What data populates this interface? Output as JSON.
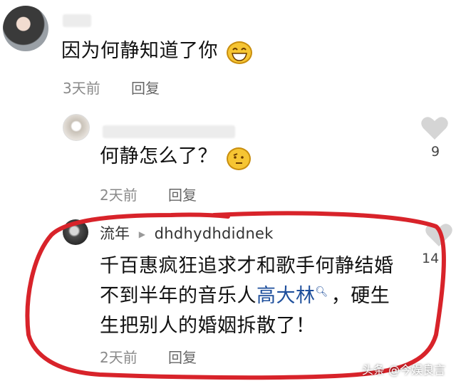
{
  "comments": [
    {
      "text": "因为何静知道了你",
      "time": "3天前",
      "reply_label": "回复"
    },
    {
      "text": "何静怎么了？",
      "time": "2天前",
      "reply_label": "回复",
      "likes": "9"
    },
    {
      "author": "流年",
      "reply_to": "dhdhydhdidnek",
      "text_line1": "千百惠疯狂追求才和歌手何静结婚",
      "text_line2_pre": "不到半年的音乐人",
      "mention": "高大林",
      "text_line2_post": "，硬生",
      "text_line3": "生把别人的婚姻拆散了！",
      "time": "2天前",
      "reply_label": "回复",
      "likes": "14"
    }
  ],
  "watermark": "头条 @今娱良言",
  "colors": {
    "highlight_circle": "#d8232a",
    "mention": "#1e4f9c",
    "meta_text": "#8a8a8a"
  },
  "icons": [
    "grin-emoji-icon",
    "thinking-emoji-icon",
    "heart-icon",
    "search-icon",
    "reply-arrow-icon"
  ]
}
